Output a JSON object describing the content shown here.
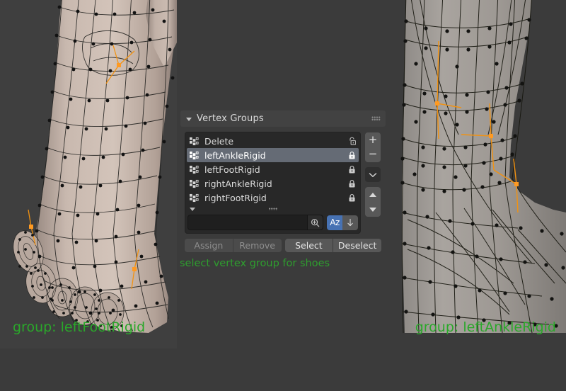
{
  "app": {
    "background_color": "#3b3b3b",
    "accent_blue": "#4772b3",
    "selection_orange": "#ff9a22",
    "caption_green": "#2aa82a"
  },
  "viewports": {
    "left": {
      "name": "left-viewport",
      "mesh_color": "#c4b4ab",
      "background_color": "#3f3f3f",
      "caption": "group: leftFootRigid"
    },
    "right": {
      "name": "right-viewport",
      "mesh_color": "#9a9590",
      "background_color": "#3b3b3b",
      "caption": "group: leftAnkleRigid"
    }
  },
  "annotation": {
    "note": "select vertex group for shoes"
  },
  "panel": {
    "title": "Vertex Groups",
    "expanded": true,
    "collapse_icon": "triangle-down-icon",
    "grip_icon": "drag-grip-icon",
    "list": {
      "rows": [
        {
          "label": "Delete",
          "icon": "vertex-group-icon",
          "lock": "unlocked",
          "selected": false
        },
        {
          "label": "leftAnkleRigid",
          "icon": "vertex-group-icon",
          "lock": "locked",
          "selected": true
        },
        {
          "label": "leftFootRigid",
          "icon": "vertex-group-icon",
          "lock": "locked",
          "selected": false
        },
        {
          "label": "rightAnkleRigid",
          "icon": "vertex-group-icon",
          "lock": "locked",
          "selected": false
        },
        {
          "label": "rightFootRigid",
          "icon": "vertex-group-icon",
          "lock": "locked",
          "selected": false
        }
      ],
      "expand_icon": "triangle-down-icon",
      "resize_grip_icon": "drag-grip-icon"
    },
    "search": {
      "value": "",
      "placeholder": "",
      "button_icon": "magnifier-plus-icon"
    },
    "sort": {
      "alpha_label": "Az",
      "alpha_active": true,
      "reverse_icon": "arrow-down-icon",
      "reverse_active": false
    },
    "side_buttons": [
      {
        "name": "add-group-button",
        "icon": "plus-icon",
        "label": "+"
      },
      {
        "name": "remove-group-button",
        "icon": "minus-icon",
        "label": "−"
      },
      {
        "name": "specials-menu-button",
        "icon": "chevron-down-icon",
        "label": ""
      },
      {
        "name": "move-group-up-button",
        "icon": "triangle-up-icon",
        "label": ""
      },
      {
        "name": "move-group-down-button",
        "icon": "triangle-down-icon",
        "label": ""
      }
    ],
    "actions": [
      {
        "name": "assign-button",
        "label": "Assign",
        "enabled": false
      },
      {
        "name": "remove-button",
        "label": "Remove",
        "enabled": false
      },
      {
        "name": "select-button",
        "label": "Select",
        "enabled": true
      },
      {
        "name": "deselect-button",
        "label": "Deselect",
        "enabled": true
      }
    ]
  }
}
